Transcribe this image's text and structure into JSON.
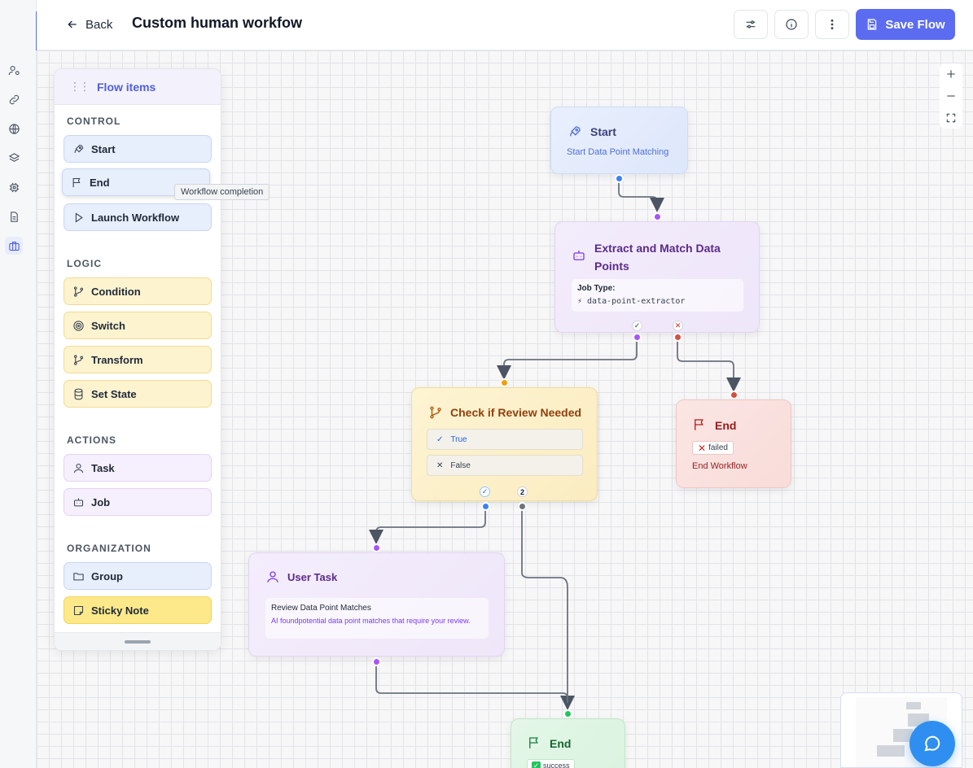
{
  "header": {
    "back_label": "Back",
    "title": "Custom human workfow",
    "save_label": "Save Flow"
  },
  "panel": {
    "title": "Flow items",
    "sections": [
      {
        "name": "CONTROL",
        "items": [
          "Start",
          "End",
          "Launch Workflow"
        ]
      },
      {
        "name": "LOGIC",
        "items": [
          "Condition",
          "Switch",
          "Transform",
          "Set State"
        ]
      },
      {
        "name": "ACTIONS",
        "items": [
          "Task",
          "Job"
        ]
      },
      {
        "name": "ORGANIZATION",
        "items": [
          "Group",
          "Sticky Note"
        ]
      }
    ],
    "tooltip": "Workflow completion"
  },
  "nodes": {
    "start": {
      "title": "Start",
      "subtitle": "Start Data Point Matching"
    },
    "extract": {
      "title": "Extract and Match Data Points",
      "job_type_label": "Job Type:",
      "job_type_value": "⚡ data-point-extractor",
      "true_tag": "✓",
      "false_tag": "✕"
    },
    "check": {
      "title": "Check if Review Needed",
      "option_true": "True",
      "option_false": "False",
      "tag_true": "✓",
      "tag_false": "2"
    },
    "end_failed": {
      "title": "End",
      "badge": "failed",
      "subtitle": "End Workflow"
    },
    "user_task": {
      "title": "User Task",
      "box_title": "Review Data Point Matches",
      "box_desc": "AI foundpotential data point matches that require your review."
    },
    "end_success": {
      "title": "End",
      "badge": "success"
    }
  },
  "colors": {
    "accent": "#5b6cf0",
    "start_node": "#e7eefc",
    "job_node": "#f3ecfb",
    "condition_node": "#fdf3cf",
    "end_failed_node": "#fbe3e1",
    "end_success_node": "#e2f6e6",
    "chat_button": "#2f8ff0"
  }
}
